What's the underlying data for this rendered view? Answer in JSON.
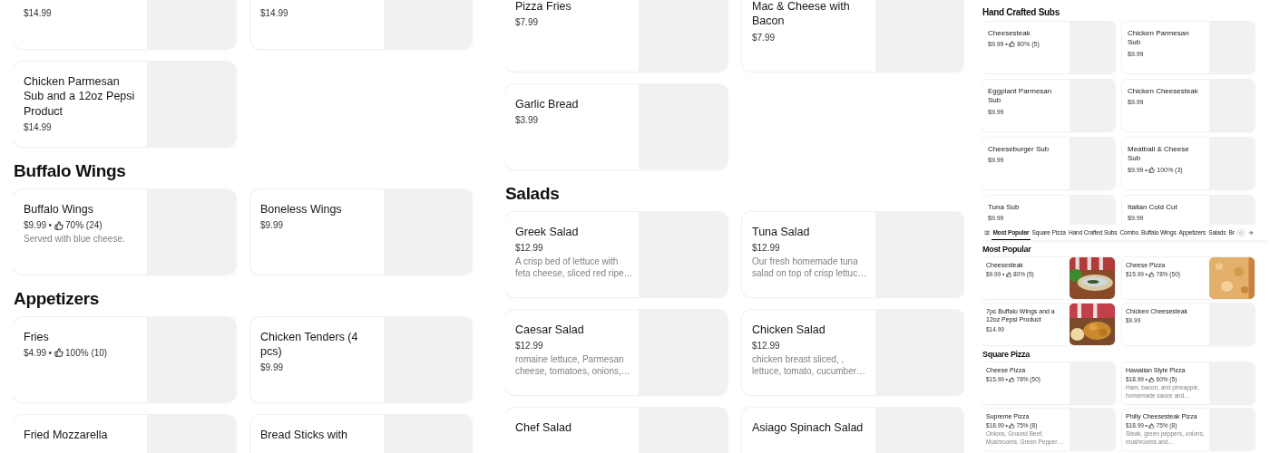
{
  "panels": [
    {
      "blocks": [
        {
          "kind": "section",
          "items": [
            {
              "price": "$14.99"
            },
            {
              "price": "$14.99"
            },
            {
              "name": "Chicken Parmesan Sub and a 12oz Pepsi Product",
              "price": "$14.99"
            }
          ]
        },
        {
          "kind": "section",
          "heading": "Buffalo Wings",
          "items": [
            {
              "name": "Buffalo Wings",
              "price": "$9.99",
              "rating": {
                "separator": "•",
                "score": "70% (24)"
              },
              "description": "Served with blue cheese."
            },
            {
              "name": "Boneless Wings",
              "price": "$9.99"
            }
          ]
        },
        {
          "kind": "section",
          "heading": "Appetizers",
          "items": [
            {
              "name": "Fries",
              "price": "$4.99",
              "rating": {
                "separator": "•",
                "score": "100% (10)"
              }
            },
            {
              "name": "Chicken Tenders (4 pcs)",
              "price": "$9.99"
            },
            {
              "name": "Fried Mozzarella"
            },
            {
              "name": "Bread Sticks with"
            }
          ]
        }
      ]
    },
    {
      "blocks": [
        {
          "kind": "section",
          "items": [
            {
              "name": "Pizza Fries",
              "price": "$7.99"
            },
            {
              "name": "Mac & Cheese with Bacon",
              "price": "$7.99"
            },
            {
              "name": "Garlic Bread",
              "price": "$3.99"
            }
          ]
        },
        {
          "kind": "section",
          "heading": "Salads",
          "items": [
            {
              "name": "Greek Salad",
              "price": "$12.99",
              "description": "A crisp bed of lettuce with feta cheese, sliced red ripe…"
            },
            {
              "name": "Tuna Salad",
              "price": "$12.99",
              "description": "Our fresh homemade tuna salad on top of crisp lettuc…"
            },
            {
              "name": "Caesar Salad",
              "price": "$12.99",
              "description": "romaine lettuce, Parmesan cheese, tomatoes, onions,…"
            },
            {
              "name": "Chicken Salad",
              "price": "$12.99",
              "description": "chicken breast sliced, , lettuce, tomato, cucumber…"
            },
            {
              "name": "Chef Salad"
            },
            {
              "name": "Asiago Spinach Salad"
            }
          ]
        }
      ]
    },
    {
      "blocks": [
        {
          "kind": "section",
          "heading": "Hand Crafted Subs",
          "items": [
            {
              "name": "Cheesesteak",
              "price": "$9.99",
              "rating": {
                "separator": "•",
                "score": "80% (5)"
              }
            },
            {
              "name": "Chicken Parmesan Sub",
              "price": "$9.99"
            },
            {
              "name": "Eggplant Parmesan Sub",
              "price": "$9.99"
            },
            {
              "name": "Chicken Cheesesteak",
              "price": "$9.99"
            },
            {
              "name": "Cheeseburger Sub",
              "price": "$9.99"
            },
            {
              "name": "Meatball & Cheese Sub",
              "price": "$9.99",
              "rating": {
                "separator": "•",
                "score": "100% (3)"
              }
            },
            {
              "name": "Tuna Sub",
              "price": "$9.99"
            },
            {
              "name": "Italian Cold Cut",
              "price": "$9.99"
            }
          ]
        },
        {
          "kind": "tab_bar",
          "tabs": [
            {
              "label": "Most Popular",
              "selected": true
            },
            {
              "label": "Square Pizza",
              "selected": false
            },
            {
              "label": "Hand Crafted Subs",
              "selected": false
            },
            {
              "label": "Combo",
              "selected": false
            },
            {
              "label": "Buffalo Wings",
              "selected": false
            },
            {
              "label": "Appetizers",
              "selected": false
            },
            {
              "label": "Salads",
              "selected": false
            },
            {
              "label": "Br",
              "selected": false
            }
          ],
          "prev": {
            "disabled": true
          },
          "next": {
            "disabled": false
          }
        },
        {
          "kind": "section",
          "heading": "Most Popular",
          "items": [
            {
              "name": "Cheesesteak",
              "price": "$9.99",
              "rating": {
                "separator": "•",
                "score": "80% (5)"
              }
            },
            {
              "name": "Cheese Pizza",
              "price": "$15.99",
              "rating": {
                "separator": "•",
                "score": "78% (50)"
              }
            },
            {
              "name": "7pc Buffalo Wings and a 12oz Pepsi Product",
              "price": "$14.99"
            },
            {
              "name": "Chicken Cheesesteak",
              "price": "$9.99"
            }
          ]
        },
        {
          "kind": "section",
          "heading": "Square Pizza",
          "items": [
            {
              "name": "Cheese Pizza",
              "price": "$15.99",
              "rating": {
                "separator": "•",
                "score": "78% (50)"
              }
            },
            {
              "name": "Hawaiian Style Pizza",
              "price": "$18.99",
              "rating": {
                "separator": "•",
                "score": "60% (5)"
              },
              "description": "Ham, bacon, and pineapple, homemade sauce and…"
            },
            {
              "name": "Supreme Pizza",
              "price": "$18.99",
              "rating": {
                "separator": "•",
                "score": "75% (8)"
              },
              "description": "Onions, Ground Beef, Mushrooms, Green Pepper…"
            },
            {
              "name": "Philly Cheesesteak Pizza",
              "price": "$18.99",
              "rating": {
                "separator": "•",
                "score": "75% (8)"
              },
              "description": "Steak, green peppers, onions, mushrooms and…"
            }
          ]
        }
      ]
    }
  ]
}
